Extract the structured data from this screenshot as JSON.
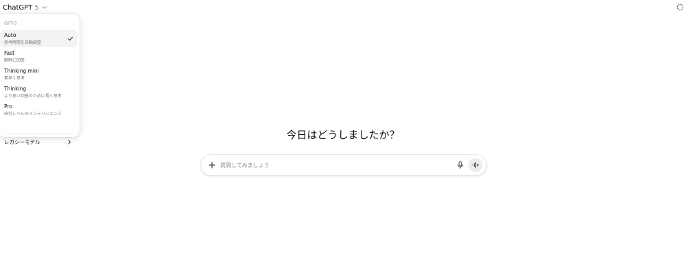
{
  "header": {
    "model_name": "ChatGPT",
    "model_version": "5"
  },
  "model_menu": {
    "section_header": "GPT-5",
    "items": [
      {
        "label": "Auto",
        "description": "思考時間を自動調整",
        "selected": true
      },
      {
        "label": "Fast",
        "description": "瞬時に回答",
        "selected": false
      },
      {
        "label": "Thinking mini",
        "description": "素早く思考",
        "selected": false
      },
      {
        "label": "Thinking",
        "description": "より良い回答のために長く思考",
        "selected": false
      },
      {
        "label": "Pro",
        "description": "研究レベルのインテリジェンス",
        "selected": false
      }
    ],
    "legacy_label": "レガシーモデル"
  },
  "main": {
    "greeting": "今日はどうしましたか？"
  },
  "composer": {
    "placeholder": "質問してみましょう"
  },
  "icons": {
    "model_chevron": "chevron-down-icon",
    "temporary_chat": "dashed-circle-icon",
    "selected_check": "check-icon",
    "legacy_chevron": "chevron-right-icon",
    "attach": "plus-icon",
    "dictate": "microphone-icon",
    "voice_mode": "waveform-icon"
  }
}
